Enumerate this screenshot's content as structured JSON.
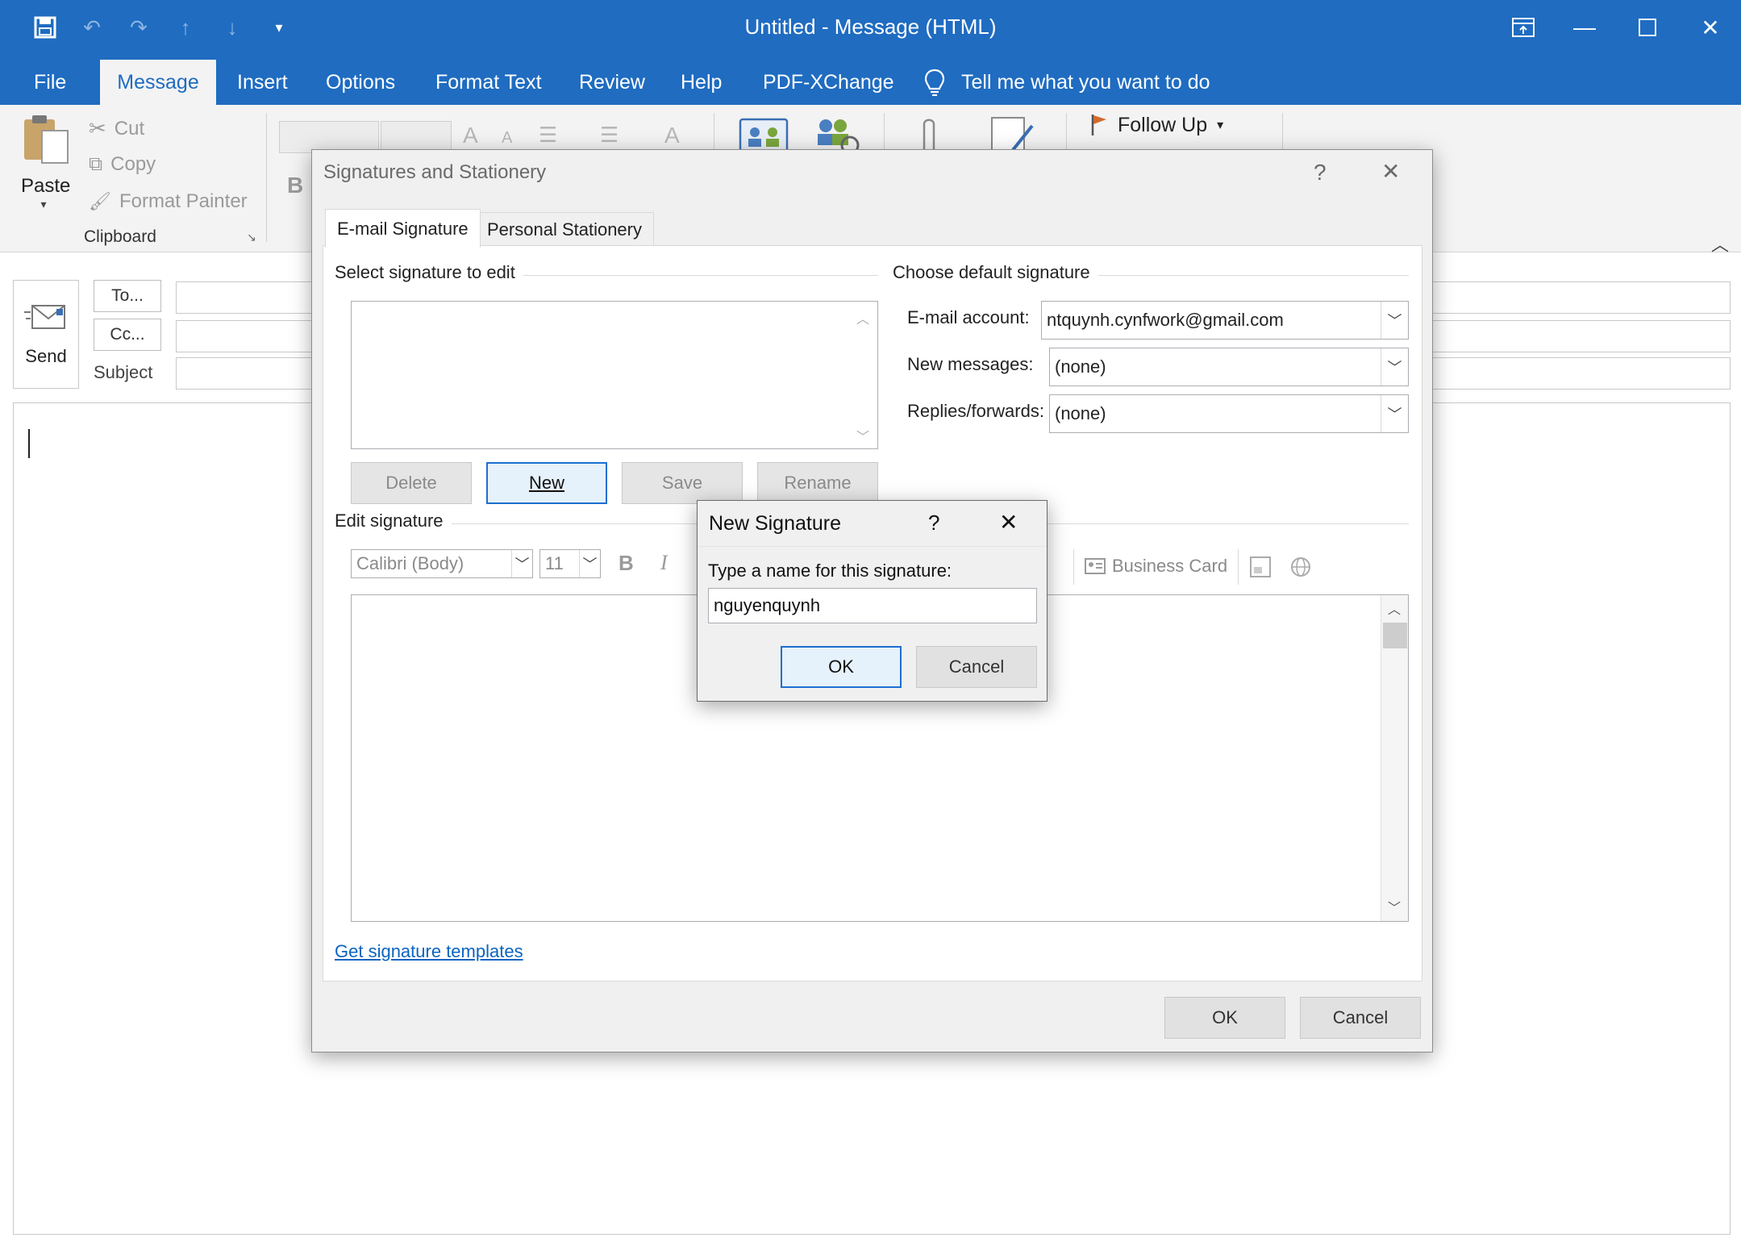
{
  "window": {
    "title": "Untitled  -  Message (HTML)"
  },
  "ribbon": {
    "tabs": [
      "File",
      "Message",
      "Insert",
      "Options",
      "Format Text",
      "Review",
      "Help",
      "PDF-XChange"
    ],
    "tell_me": "Tell me what you want to do",
    "paste_label": "Paste",
    "cut_label": "Cut",
    "copy_label": "Copy",
    "format_painter_label": "Format Painter",
    "clipboard_group": "Clipboard",
    "follow_up_label": "Follow Up"
  },
  "compose": {
    "send_label": "Send",
    "to_label": "To...",
    "cc_label": "Cc...",
    "subject_label": "Subject"
  },
  "signatures_dialog": {
    "title": "Signatures and Stationery",
    "tabs": [
      "E-mail Signature",
      "Personal Stationery"
    ],
    "select_signature_label": "Select signature to edit",
    "buttons": {
      "delete": "Delete",
      "new": "New",
      "save": "Save",
      "rename": "Rename"
    },
    "choose_default_label": "Choose default signature",
    "email_account_label": "E-mail account:",
    "email_account_value": "ntquynh.cynfwork@gmail.com",
    "new_messages_label": "New messages:",
    "new_messages_value": "(none)",
    "replies_label": "Replies/forwards:",
    "replies_value": "(none)",
    "edit_signature_label": "Edit signature",
    "font_value": "Calibri (Body)",
    "size_value": "11",
    "business_card_label": "Business Card",
    "templates_link": "Get signature templates",
    "ok": "OK",
    "cancel": "Cancel"
  },
  "new_signature_dialog": {
    "title": "New Signature",
    "help": "?",
    "prompt": "Type a name for this signature:",
    "name_value": "nguyenquynh",
    "ok": "OK",
    "cancel": "Cancel"
  }
}
